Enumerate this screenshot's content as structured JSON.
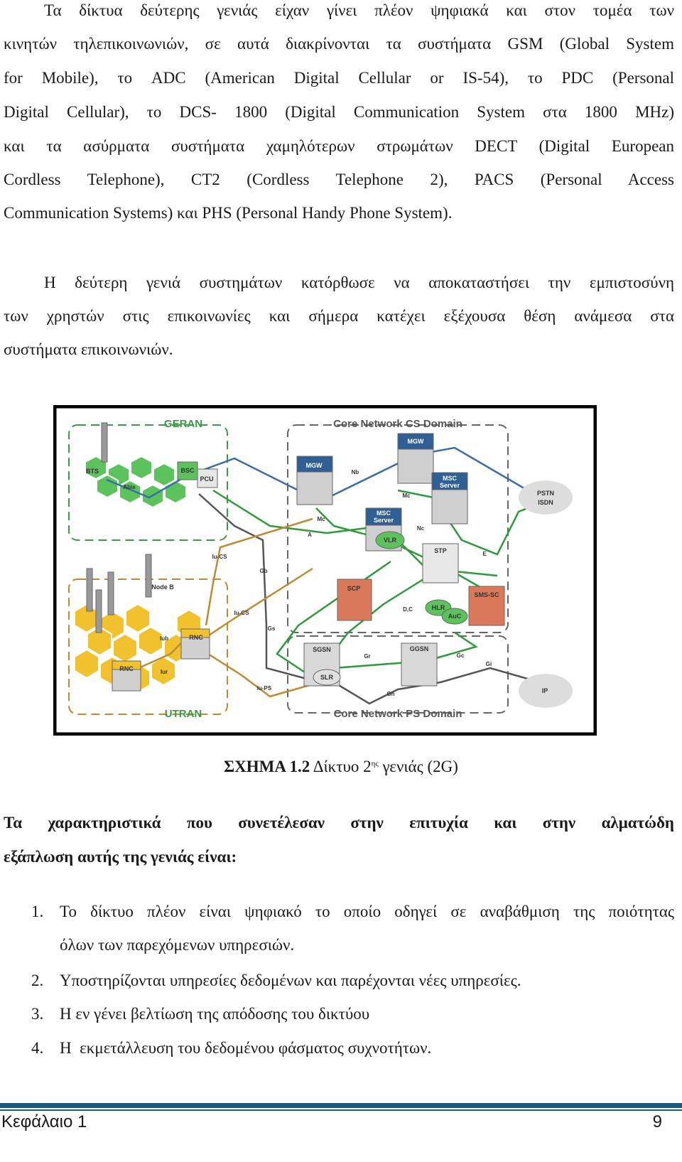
{
  "paragraph1": [
    "Τα δίκτυα δεύτερης γενιάς είχαν γίνει πλέον ψηφιακά και στον τομέα των",
    "κινητών τηλεπικοινωνιών, σε αυτά διακρίνονται τα συστήματα GSM (Global System",
    "for Mobile), το ADC (American Digital Cellular or IS-54), το PDC (Personal",
    "Digital Cellular), το DCS- 1800 (Digital Communication System στα 1800 MHz)",
    "και τα ασύρματα συστήματα χαμηλότερων στρωμάτων DECT (Digital European",
    "Cordless Telephone), CT2 (Cordless Telephone 2), PACS (Personal Access",
    "Communication Systems) και PHS (Personal Handy Phone System)."
  ],
  "paragraph2": [
    "Η δεύτερη γενιά συστημάτων κατόρθωσε να αποκαταστήσει την εμπιστοσύνη",
    "των χρηστών στις επικοινωνίες και σήμερα κατέχει εξέχουσα θέση ανάμεσα στα",
    "συστήματα επικοινωνιών."
  ],
  "figure": {
    "domains": {
      "geran": "GERAN",
      "cs": "Core Network CS Domain",
      "ps": "Core Network PS Domain",
      "utran": "UTRAN"
    },
    "nodes": {
      "bts": "BTS",
      "bsc": "BSC",
      "pcu": "PCU",
      "mgw": "MGW",
      "msc_server_1": "MSC",
      "msc_server_2": "Server",
      "vlr": "VLR",
      "stp": "STP",
      "sms_sc": "SMS-SC",
      "scp": "SCP",
      "hlr": "HLR",
      "auc": "AuC",
      "sgsn": "SGSN",
      "slr": "SLR",
      "ggsn": "GGSN",
      "pstn": "PSTN",
      "isdn": "ISDN",
      "ip": "IP",
      "node_b": "Node B",
      "rnc": "RNC"
    },
    "interfaces": {
      "abis": "Abis",
      "nb": "Nb",
      "mc": "Mc",
      "a": "A",
      "nc": "Nc",
      "e": "E",
      "iu_cs": "Iu-CS",
      "gb": "Gb",
      "gs": "Gs",
      "dc": "D,C",
      "iub": "Iub",
      "iur": "Iur",
      "iu_ps": "Iu-PS",
      "gr": "Gr",
      "gc": "Gc",
      "gi": "Gi",
      "gn": "Gn"
    },
    "caption": {
      "label": "ΣΧΗΜΑ 1.2",
      "text_before": "Δίκτυο 2",
      "superscript": "ης",
      "text_after": "γενιάς (2G)"
    }
  },
  "paragraph3": [
    "Τα χαρακτηριστικά που συνετέλεσαν στην επιτυχία και στην αλματώδη",
    "εξάπλωση αυτής της γενιάς είναι:"
  ],
  "list": [
    {
      "num": "1.",
      "lines": [
        "Το δίκτυο πλέον είναι ψηφιακό το οποίο οδηγεί σε αναβάθμιση της ποιότητας",
        "όλων των παρεχόμενων υπηρεσιών."
      ]
    },
    {
      "num": "2.",
      "lines": [
        "Υποστηρίζονται υπηρεσίες δεδομένων και παρέχονται νέες υπηρεσίες."
      ]
    },
    {
      "num": "3.",
      "lines": [
        "Η εν γένει βελτίωση της απόδοσης του δικτύου"
      ]
    },
    {
      "num": "4.",
      "lines": [
        "Η  εκμετάλλευση του δεδομένου φάσματος συχνοτήτων."
      ]
    }
  ],
  "footer": {
    "chapter": "Κεφάλαιο 1",
    "page": "9",
    "rule_color": "#1f5a7a"
  },
  "colors": {
    "geran": "#3a9a45",
    "utran": "#f2c12e",
    "mgw": "#2f5f95",
    "scp": "#d9795a",
    "cs_line": "#3a6ea5",
    "iu_line": "#c08a30"
  }
}
